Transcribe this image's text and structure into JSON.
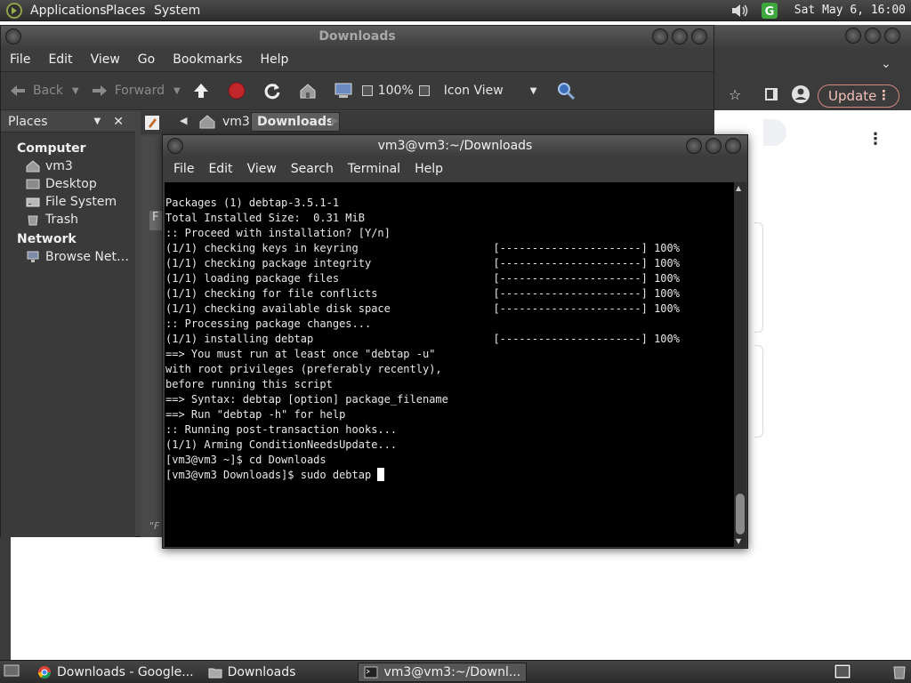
{
  "top_panel": {
    "menus": [
      "Applications",
      "Places",
      "System"
    ],
    "clock": "Sat May  6, 16:00"
  },
  "chrome": {
    "update_label": "Update",
    "menu_dots": "⋮"
  },
  "file_manager": {
    "title": "Downloads",
    "menus": [
      "File",
      "Edit",
      "View",
      "Go",
      "Bookmarks",
      "Help"
    ],
    "toolbar": {
      "back": "Back",
      "forward": "Forward",
      "zoom": "100%",
      "view_mode": "Icon View"
    },
    "sidebar": {
      "header": "Places",
      "computer_label": "Computer",
      "computer_items": [
        "vm3",
        "Desktop",
        "File System",
        "Trash"
      ],
      "network_label": "Network",
      "network_items": [
        "Browse Net…"
      ]
    },
    "path": [
      "vm3",
      "Downloads"
    ],
    "partial_text": "F",
    "status_partial": "\"F"
  },
  "terminal": {
    "title": "vm3@vm3:~/Downloads",
    "menus": [
      "File",
      "Edit",
      "View",
      "Search",
      "Terminal",
      "Help"
    ],
    "lines": [
      "Packages (1) debtap-3.5.1-1",
      "",
      "Total Installed Size:  0.31 MiB",
      "",
      ":: Proceed with installation? [Y/n]",
      "(1/1) checking keys in keyring                     [----------------------] 100%",
      "(1/1) checking package integrity                   [----------------------] 100%",
      "(1/1) loading package files                        [----------------------] 100%",
      "(1/1) checking for file conflicts                  [----------------------] 100%",
      "(1/1) checking available disk space                [----------------------] 100%",
      ":: Processing package changes...",
      "(1/1) installing debtap                            [----------------------] 100%",
      "==> You must run at least once \"debtap -u\"",
      "with root privileges (preferably recently),",
      "before running this script",
      "",
      "==> Syntax: debtap [option] package_filename",
      "",
      "==> Run \"debtap -h\" for help",
      ":: Running post-transaction hooks...",
      "(1/1) Arming ConditionNeedsUpdate...",
      "[vm3@vm3 ~]$ cd Downloads"
    ],
    "prompt_line": "[vm3@vm3 Downloads]$ sudo debtap "
  },
  "taskbar": {
    "tasks": [
      "Downloads - Google...",
      "Downloads",
      "vm3@vm3:~/Downl..."
    ]
  }
}
